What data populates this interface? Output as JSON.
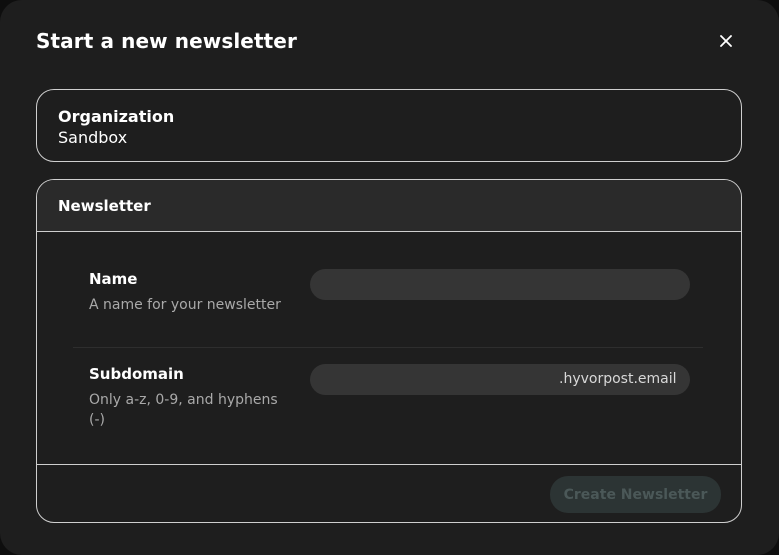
{
  "dialog": {
    "title": "Start a new newsletter",
    "close_icon": "close-icon"
  },
  "organization": {
    "label": "Organization",
    "value": "Sandbox"
  },
  "newsletter": {
    "section_title": "Newsletter",
    "name": {
      "label": "Name",
      "help": "A name for your newsletter",
      "value": ""
    },
    "subdomain": {
      "label": "Subdomain",
      "help": "Only a-z, 0-9, and hyphens (-)",
      "value": "",
      "suffix": ".hyvorpost.email"
    },
    "create_label": "Create Newsletter"
  }
}
